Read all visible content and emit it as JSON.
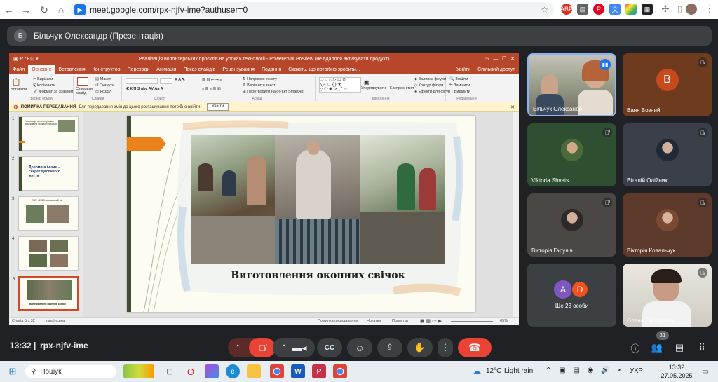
{
  "browser": {
    "url": "meet.google.com/rpx-njfv-ime?authuser=0",
    "extensions": [
      "ABP",
      "tabs-icon",
      "pinterest-icon",
      "translate-icon",
      "color-picker-icon",
      "qr-icon",
      "puzzle-icon",
      "sidebar-icon",
      "profile-avatar"
    ]
  },
  "meet": {
    "presenter_initial": "Б",
    "presenter_title": "Більчук Олександр (Презентація)",
    "time": "13:32",
    "meeting_code": "rpx-njfv-ime",
    "people_count": "31",
    "colors": {
      "end_call": "#ea4335",
      "mic_off": "#ea4335",
      "panel": "#3c4043"
    }
  },
  "ppt": {
    "window_title": "Реалізація волонтерських проєктів на уроках технології - PowerPoint Preview (не вдалося активувати продукт)",
    "tabs": [
      "Файл",
      "Основне",
      "Вставлення",
      "Конструктор",
      "Переходи",
      "Анімація",
      "Показ слайдів",
      "Рецензування",
      "Подання",
      "Скажіть, що потрібно зробити..."
    ],
    "tabs_right": [
      "Увійти",
      "Спільний доступ"
    ],
    "ribbon": {
      "paste": "Вставити",
      "cut": "Вирізати",
      "copy": "Копіювати",
      "format_painter": "Формат за зразком",
      "clipboard": "Буфер обміну",
      "new_slide": "Створити слайд",
      "layout": "Макет",
      "reset": "Скинути",
      "section": "Розділ",
      "slides": "Слайди",
      "font": "Шрифт",
      "paragraph": "Абзац",
      "text_direction": "Напрямок тексту",
      "align_text": "Вирівняти текст",
      "smartart": "Перетворити на об'єкт SmartArt",
      "drawing": "Креслення",
      "arrange": "Упорядкувати",
      "quick_styles": "Експрес-стилі",
      "shape_fill": "Заливка фігури",
      "shape_outline": "Контур фігури",
      "shape_effects": "Ефекти для фігур",
      "find": "Знайти",
      "replace": "Замінити",
      "select": "Виділити",
      "editing": "Редагування"
    },
    "warning_label": "ПОМИЛКА ПЕРЕДАВАННЯ",
    "warning_text": "Для передавання змін до цього розташування потрібно ввійти.",
    "warning_button": "Увійти",
    "thumbs": [
      {
        "num": "1",
        "title": "Реалізація волонтерських проєктів на уроках технології"
      },
      {
        "num": "2",
        "title": "Допомога іншим – секрет щасливого життя"
      },
      {
        "num": "3",
        "title": "2022 - 2025 навчальний рік"
      },
      {
        "num": "4",
        "title": ""
      },
      {
        "num": "5",
        "title": "Виготовлення окопних свічок"
      }
    ],
    "slide_caption": "Виготовлення окопних свічок",
    "status": {
      "slide": "Слайд 5 з 32",
      "language": "українська",
      "upload": "Помилка передавання",
      "notes": "Нотатки",
      "comments": "Примітки",
      "zoom": "65%"
    }
  },
  "participants": [
    {
      "name": "Більчук Олександр",
      "kind": "video",
      "speaking": true
    },
    {
      "name": "Ваня Возний",
      "initial": "В",
      "kind": "letter",
      "muted": true
    },
    {
      "name": "Viktoria Shvets",
      "kind": "photo",
      "muted": true
    },
    {
      "name": "Віталій Олійник",
      "kind": "photo",
      "muted": true
    },
    {
      "name": "Вікторія Гаруліч",
      "kind": "photo",
      "muted": true
    },
    {
      "name": "Вікторія Ковальчук",
      "kind": "photo",
      "muted": true
    },
    {
      "name": "Ще 23 особи",
      "initials": [
        "A",
        "D"
      ],
      "kind": "others"
    },
    {
      "name": "Олена Саморська",
      "kind": "video",
      "muted": true
    }
  ],
  "taskbar": {
    "search": "Пошук",
    "weather": "12°C",
    "weather_text": "Light rain",
    "lang": "УКР",
    "time": "13:32",
    "date": "27.05.2025"
  }
}
